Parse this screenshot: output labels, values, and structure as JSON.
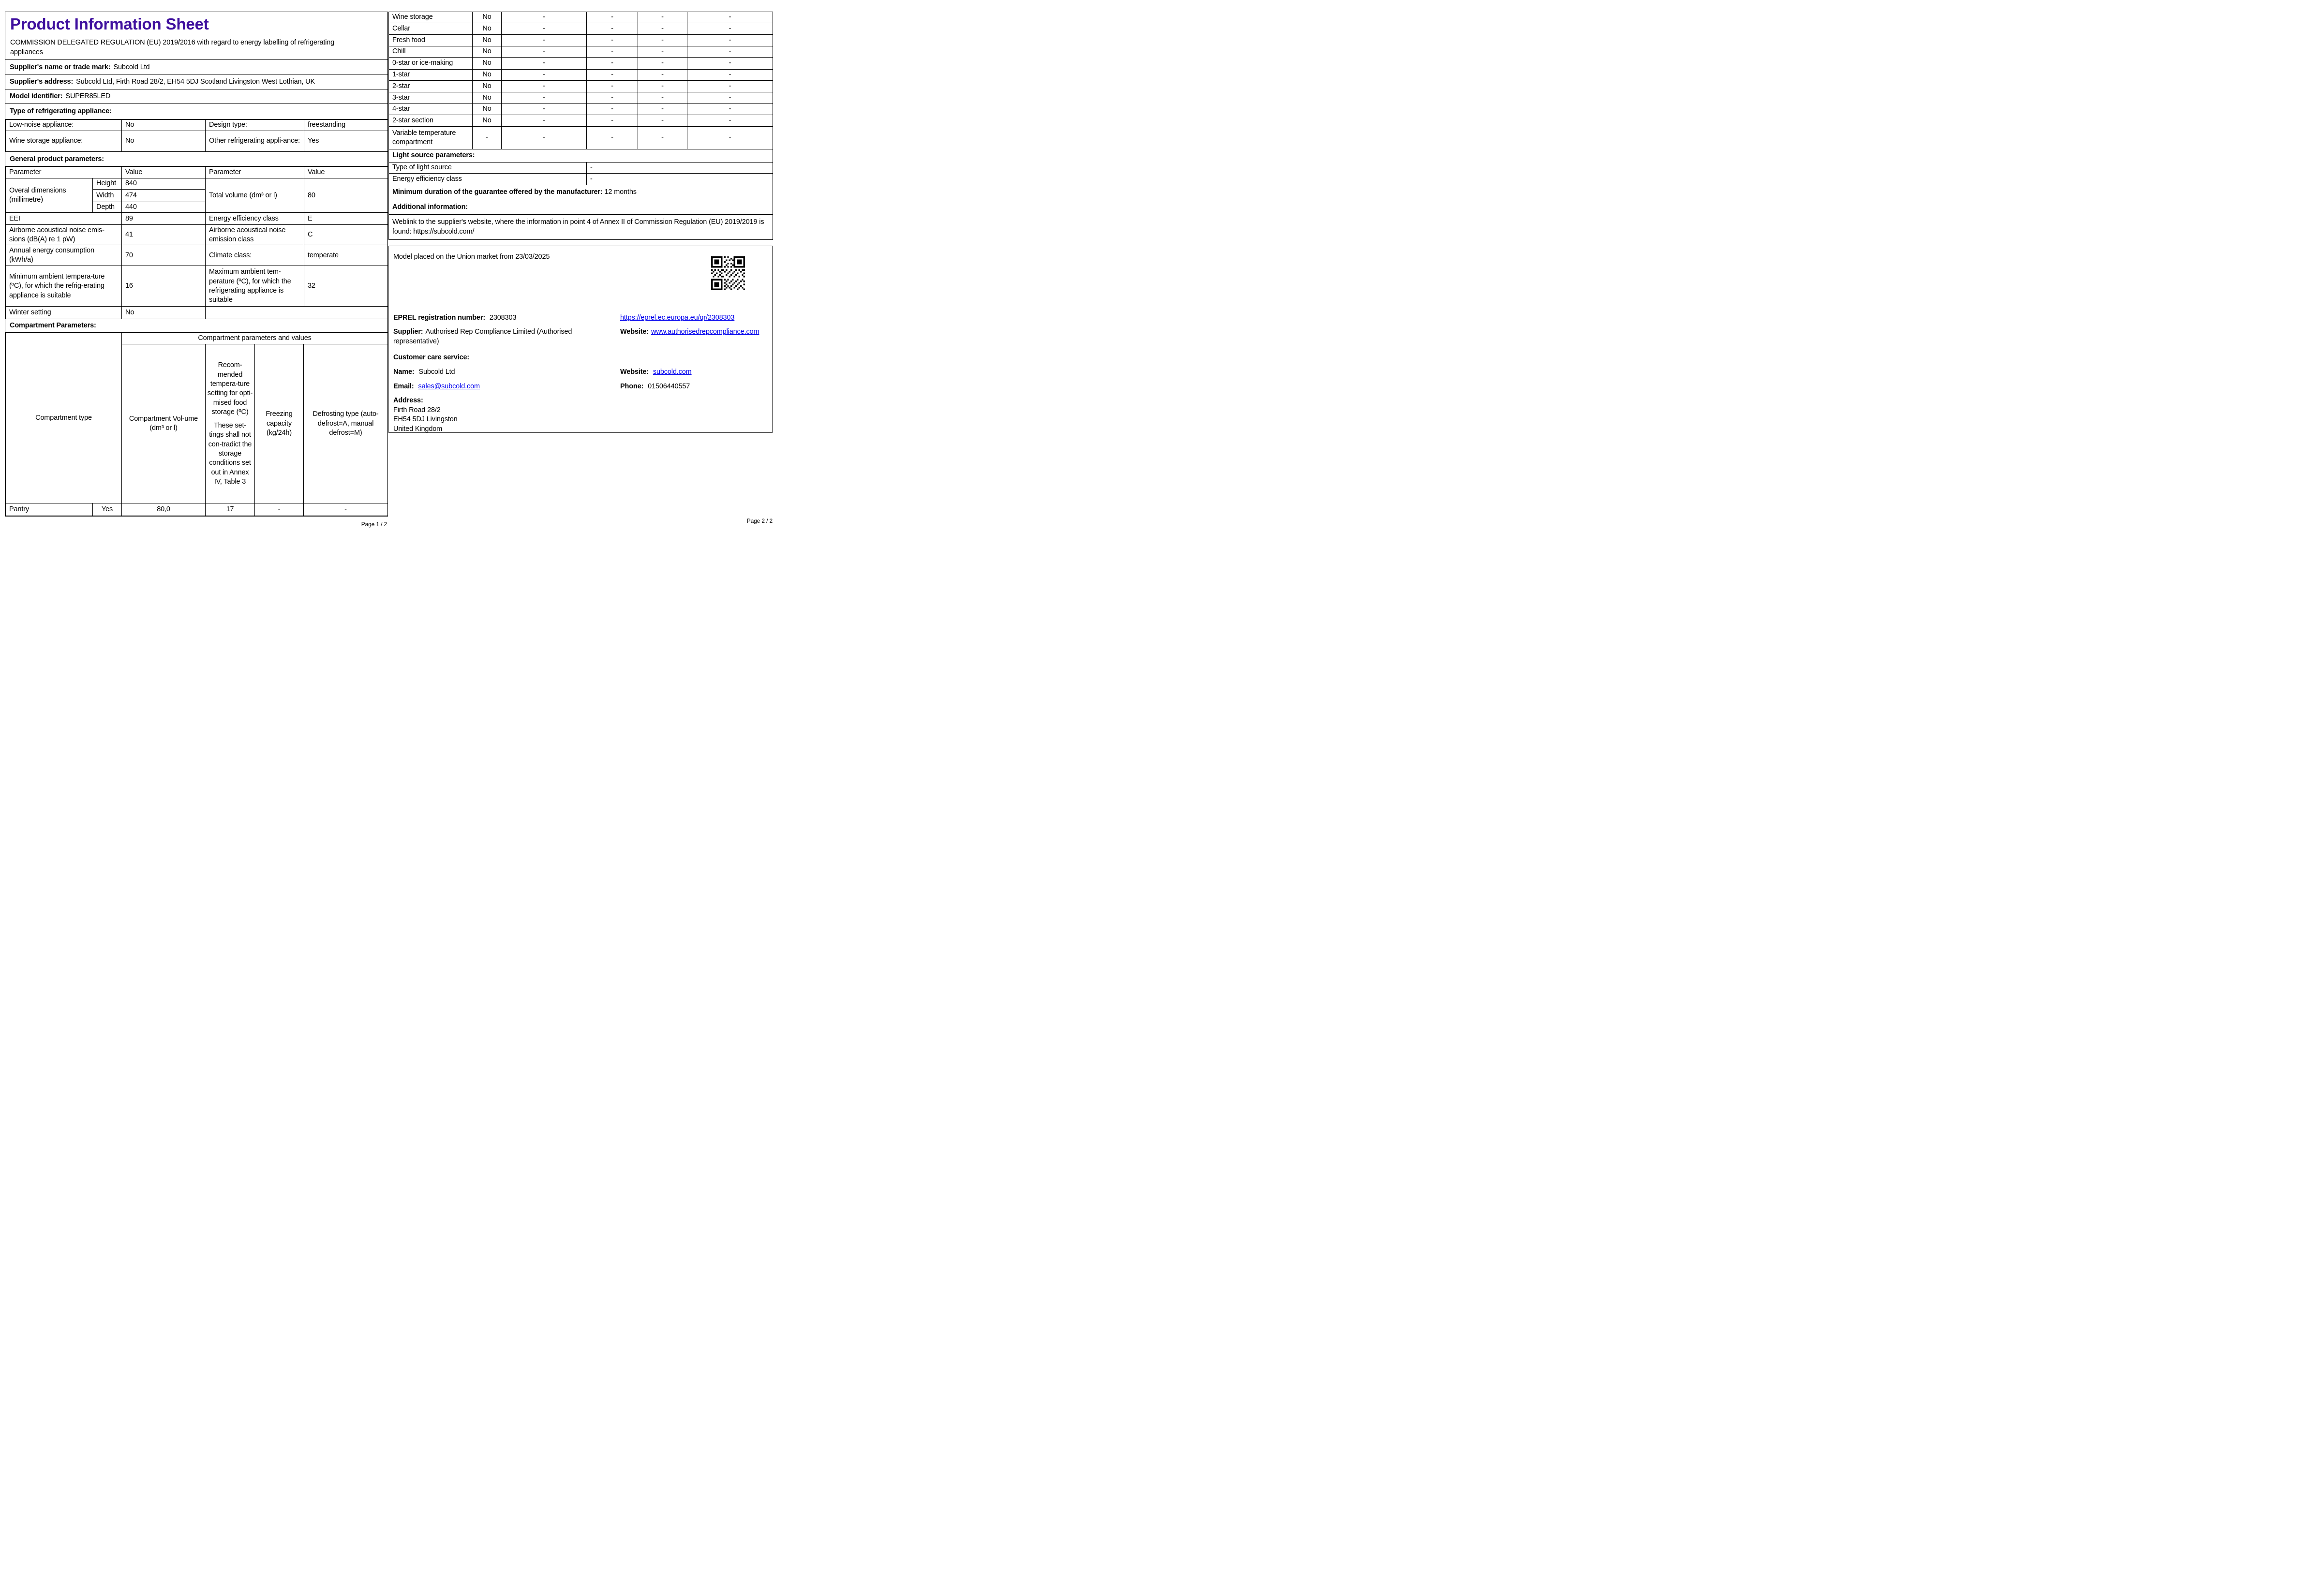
{
  "colors": {
    "title": "#3f109e",
    "link": "#0000ee",
    "border": "#000000"
  },
  "page1": {
    "title": "Product Information Sheet",
    "regulation": "COMMISSION DELEGATED REGULATION (EU) 2019/2016 with regard to energy labelling of refrigerating appliances",
    "supplier_name_label": "Supplier's name or trade mark:",
    "supplier_name_value": "Subcold Ltd",
    "supplier_address_label": "Supplier's address:",
    "supplier_address_value": "Subcold Ltd, Firth Road 28/2, EH54 5DJ Scotland Livingston West Lothian, UK",
    "model_identifier_label": "Model identifier:",
    "model_identifier_value": "SUPER85LED",
    "type_heading": "Type of refrigerating appliance:",
    "type_table": {
      "low_noise_label": "Low-noise appliance:",
      "low_noise_value": "No",
      "design_type_label": "Design type:",
      "design_type_value": "freestanding",
      "wine_storage_label": "Wine storage appliance:",
      "wine_storage_value": "No",
      "other_appliance_label": "Other refrigerating appli-ance:",
      "other_appliance_value": "Yes"
    },
    "general_heading": "General product parameters:",
    "general_table": {
      "header_parameter": "Parameter",
      "header_value": "Value",
      "dims_label": "Overal dimensions (millimetre)",
      "height_label": "Height",
      "height_value": "840",
      "width_label": "Width",
      "width_value": "474",
      "depth_label": "Depth",
      "depth_value": "440",
      "total_volume_label": "Total volume (dm³ or l)",
      "total_volume_value": "80",
      "eei_label": "EEI",
      "eei_value": "89",
      "energy_class_label": "Energy efficiency class",
      "energy_class_value": "E",
      "noise_label": "Airborne acoustical noise emis-sions (dB(A) re 1 pW)",
      "noise_value": "41",
      "noise_class_label": "Airborne acoustical noise emission class",
      "noise_class_value": "C",
      "annual_energy_label": "Annual energy consumption (kWh/a)",
      "annual_energy_value": "70",
      "climate_label": "Climate class:",
      "climate_value": "temperate",
      "min_ambient_label": "Minimum ambient tempera-ture (ºC), for which the refrig-erating appliance is suitable",
      "min_ambient_value": "16",
      "max_ambient_label": "Maximum ambient tem-perature (ºC), for which the refrigerating appliance is suitable",
      "max_ambient_value": "32",
      "winter_label": "Winter setting",
      "winter_value": "No"
    },
    "compartment_heading": "Compartment Parameters:",
    "compartment_table": {
      "type_header": "Compartment type",
      "group_header": "Compartment parameters and values",
      "volume_header": "Compartment Vol-ume (dm³ or l)",
      "temp_header_1": "Recom-mended tempera-ture setting for opti-mised food storage (ºC)",
      "temp_header_2": "These set-tings shall not con-tradict the storage conditions set out in Annex IV, Table 3",
      "freezing_header": "Freezing capacity (kg/24h)",
      "defrost_header": "Defrosting type (auto-defrost=A, manual defrost=M)",
      "row": {
        "name": "Pantry",
        "present": "Yes",
        "volume": "80,0",
        "temp": "17",
        "freezing": "-",
        "defrost": "-"
      }
    },
    "page_label": "Page 1 / 2"
  },
  "page2": {
    "compartment_rows": [
      {
        "label": "Wine storage",
        "present": "No",
        "volume": "-",
        "temp": "-",
        "freezing": "-",
        "defrost": "-"
      },
      {
        "label": "Cellar",
        "present": "No",
        "volume": "-",
        "temp": "-",
        "freezing": "-",
        "defrost": "-"
      },
      {
        "label": "Fresh food",
        "present": "No",
        "volume": "-",
        "temp": "-",
        "freezing": "-",
        "defrost": "-"
      },
      {
        "label": "Chill",
        "present": "No",
        "volume": "-",
        "temp": "-",
        "freezing": "-",
        "defrost": "-"
      },
      {
        "label": "0-star or ice-making",
        "present": "No",
        "volume": "-",
        "temp": "-",
        "freezing": "-",
        "defrost": "-"
      },
      {
        "label": "1-star",
        "present": "No",
        "volume": "-",
        "temp": "-",
        "freezing": "-",
        "defrost": "-"
      },
      {
        "label": "2-star",
        "present": "No",
        "volume": "-",
        "temp": "-",
        "freezing": "-",
        "defrost": "-"
      },
      {
        "label": "3-star",
        "present": "No",
        "volume": "-",
        "temp": "-",
        "freezing": "-",
        "defrost": "-"
      },
      {
        "label": "4-star",
        "present": "No",
        "volume": "-",
        "temp": "-",
        "freezing": "-",
        "defrost": "-"
      },
      {
        "label": "2-star section",
        "present": "No",
        "volume": "-",
        "temp": "-",
        "freezing": "-",
        "defrost": "-"
      },
      {
        "label": "Variable temperature compartment",
        "present": "-",
        "volume": "-",
        "temp": "-",
        "freezing": "-",
        "defrost": "-"
      }
    ],
    "light_heading": "Light source parameters:",
    "light_rows": [
      {
        "label": "Type of light source",
        "value": "-"
      },
      {
        "label": "Energy efficiency class",
        "value": "-"
      }
    ],
    "guarantee_label": "Minimum duration of the guarantee offered by the manufacturer:",
    "guarantee_value": "12 months",
    "additional_heading": "Additional information:",
    "weblink_text": "Weblink to the supplier's website, where the information in point 4 of Annex II of Commission Regulation (EU) 2019/2019 is found:",
    "weblink_url": "https://subcold.com/",
    "info_box": {
      "market_text": "Model placed on the Union market from 23/03/2025",
      "qr_icon": "qr-code",
      "eprel_label": "EPREL registration number:",
      "eprel_value": "2308303",
      "eprel_link": "https://eprel.ec.europa.eu/qr/2308303",
      "supplier_label": "Supplier:",
      "supplier_value": "Authorised Rep Compliance Limited (Authorised representative)",
      "website_label": "Website:",
      "website_value": "www.authorisedrepcompliance.com",
      "customer_care_heading": "Customer care service:",
      "name_label": "Name:",
      "name_value": "Subcold Ltd",
      "website2_label": "Website:",
      "website2_value": "subcold.com",
      "email_label": "Email:",
      "email_value": "sales@subcold.com",
      "phone_label": "Phone:",
      "phone_value": "01506440557",
      "address_label": "Address:",
      "address_line1": "Firth Road 28/2",
      "address_line2": " EH54 5DJ Livingston",
      "address_line3": "United Kingdom"
    },
    "page_label": "Page 2 / 2"
  }
}
